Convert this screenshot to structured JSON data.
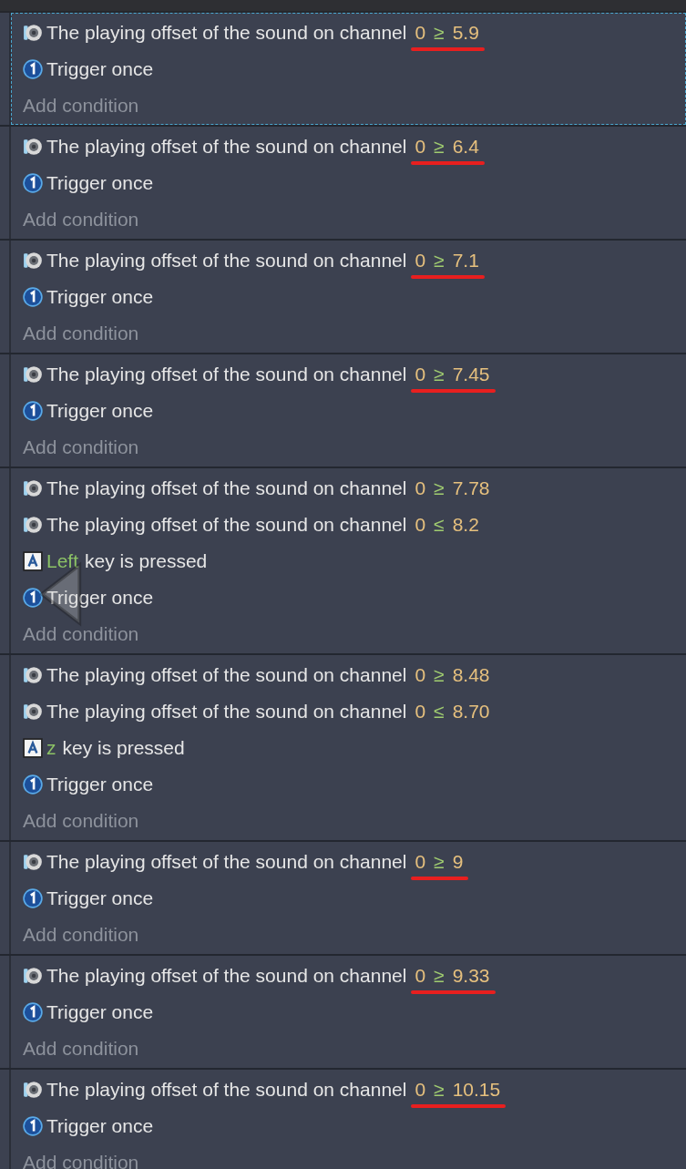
{
  "events": [
    {
      "selected": true,
      "conditions": [
        {
          "kind": "sound",
          "text": "The playing offset of the sound on channel",
          "channel": "0",
          "operator": "≥",
          "value": "5.9",
          "underlined": true
        },
        {
          "kind": "trigger",
          "text": "Trigger once"
        }
      ],
      "add_label": "Add condition"
    },
    {
      "selected": false,
      "conditions": [
        {
          "kind": "sound",
          "text": "The playing offset of the sound on channel",
          "channel": "0",
          "operator": "≥",
          "value": "6.4",
          "underlined": true
        },
        {
          "kind": "trigger",
          "text": "Trigger once"
        }
      ],
      "add_label": "Add condition"
    },
    {
      "selected": false,
      "conditions": [
        {
          "kind": "sound",
          "text": "The playing offset of the sound on channel",
          "channel": "0",
          "operator": "≥",
          "value": "7.1",
          "underlined": true
        },
        {
          "kind": "trigger",
          "text": "Trigger once"
        }
      ],
      "add_label": "Add condition"
    },
    {
      "selected": false,
      "conditions": [
        {
          "kind": "sound",
          "text": "The playing offset of the sound on channel",
          "channel": "0",
          "operator": "≥",
          "value": "7.45",
          "underlined": true
        },
        {
          "kind": "trigger",
          "text": "Trigger once"
        }
      ],
      "add_label": "Add condition"
    },
    {
      "selected": false,
      "conditions": [
        {
          "kind": "sound",
          "text": "The playing offset of the sound on channel",
          "channel": "0",
          "operator": "≥",
          "value": "7.78"
        },
        {
          "kind": "sound",
          "text": "The playing offset of the sound on channel",
          "channel": "0",
          "operator": "≤",
          "value": "8.2"
        },
        {
          "kind": "key",
          "key": "Left",
          "text": "key is pressed"
        },
        {
          "kind": "trigger",
          "text": "Trigger once"
        }
      ],
      "add_label": "Add condition"
    },
    {
      "selected": false,
      "conditions": [
        {
          "kind": "sound",
          "text": "The playing offset of the sound on channel",
          "channel": "0",
          "operator": "≥",
          "value": "8.48"
        },
        {
          "kind": "sound",
          "text": "The playing offset of the sound on channel",
          "channel": "0",
          "operator": "≤",
          "value": "8.70"
        },
        {
          "kind": "key",
          "key": "z",
          "text": "key is pressed"
        },
        {
          "kind": "trigger",
          "text": "Trigger once"
        }
      ],
      "add_label": "Add condition"
    },
    {
      "selected": false,
      "conditions": [
        {
          "kind": "sound",
          "text": "The playing offset of the sound on channel",
          "channel": "0",
          "operator": "≥",
          "value": "9",
          "underlined": true
        },
        {
          "kind": "trigger",
          "text": "Trigger once"
        }
      ],
      "add_label": "Add condition"
    },
    {
      "selected": false,
      "conditions": [
        {
          "kind": "sound",
          "text": "The playing offset of the sound on channel",
          "channel": "0",
          "operator": "≥",
          "value": "9.33",
          "underlined": true
        },
        {
          "kind": "trigger",
          "text": "Trigger once"
        }
      ],
      "add_label": "Add condition"
    },
    {
      "selected": false,
      "conditions": [
        {
          "kind": "sound",
          "text": "The playing offset of the sound on channel",
          "channel": "0",
          "operator": "≥",
          "value": "10.15",
          "underlined": true
        },
        {
          "kind": "trigger",
          "text": "Trigger once"
        }
      ],
      "add_label": "Add condition"
    }
  ]
}
